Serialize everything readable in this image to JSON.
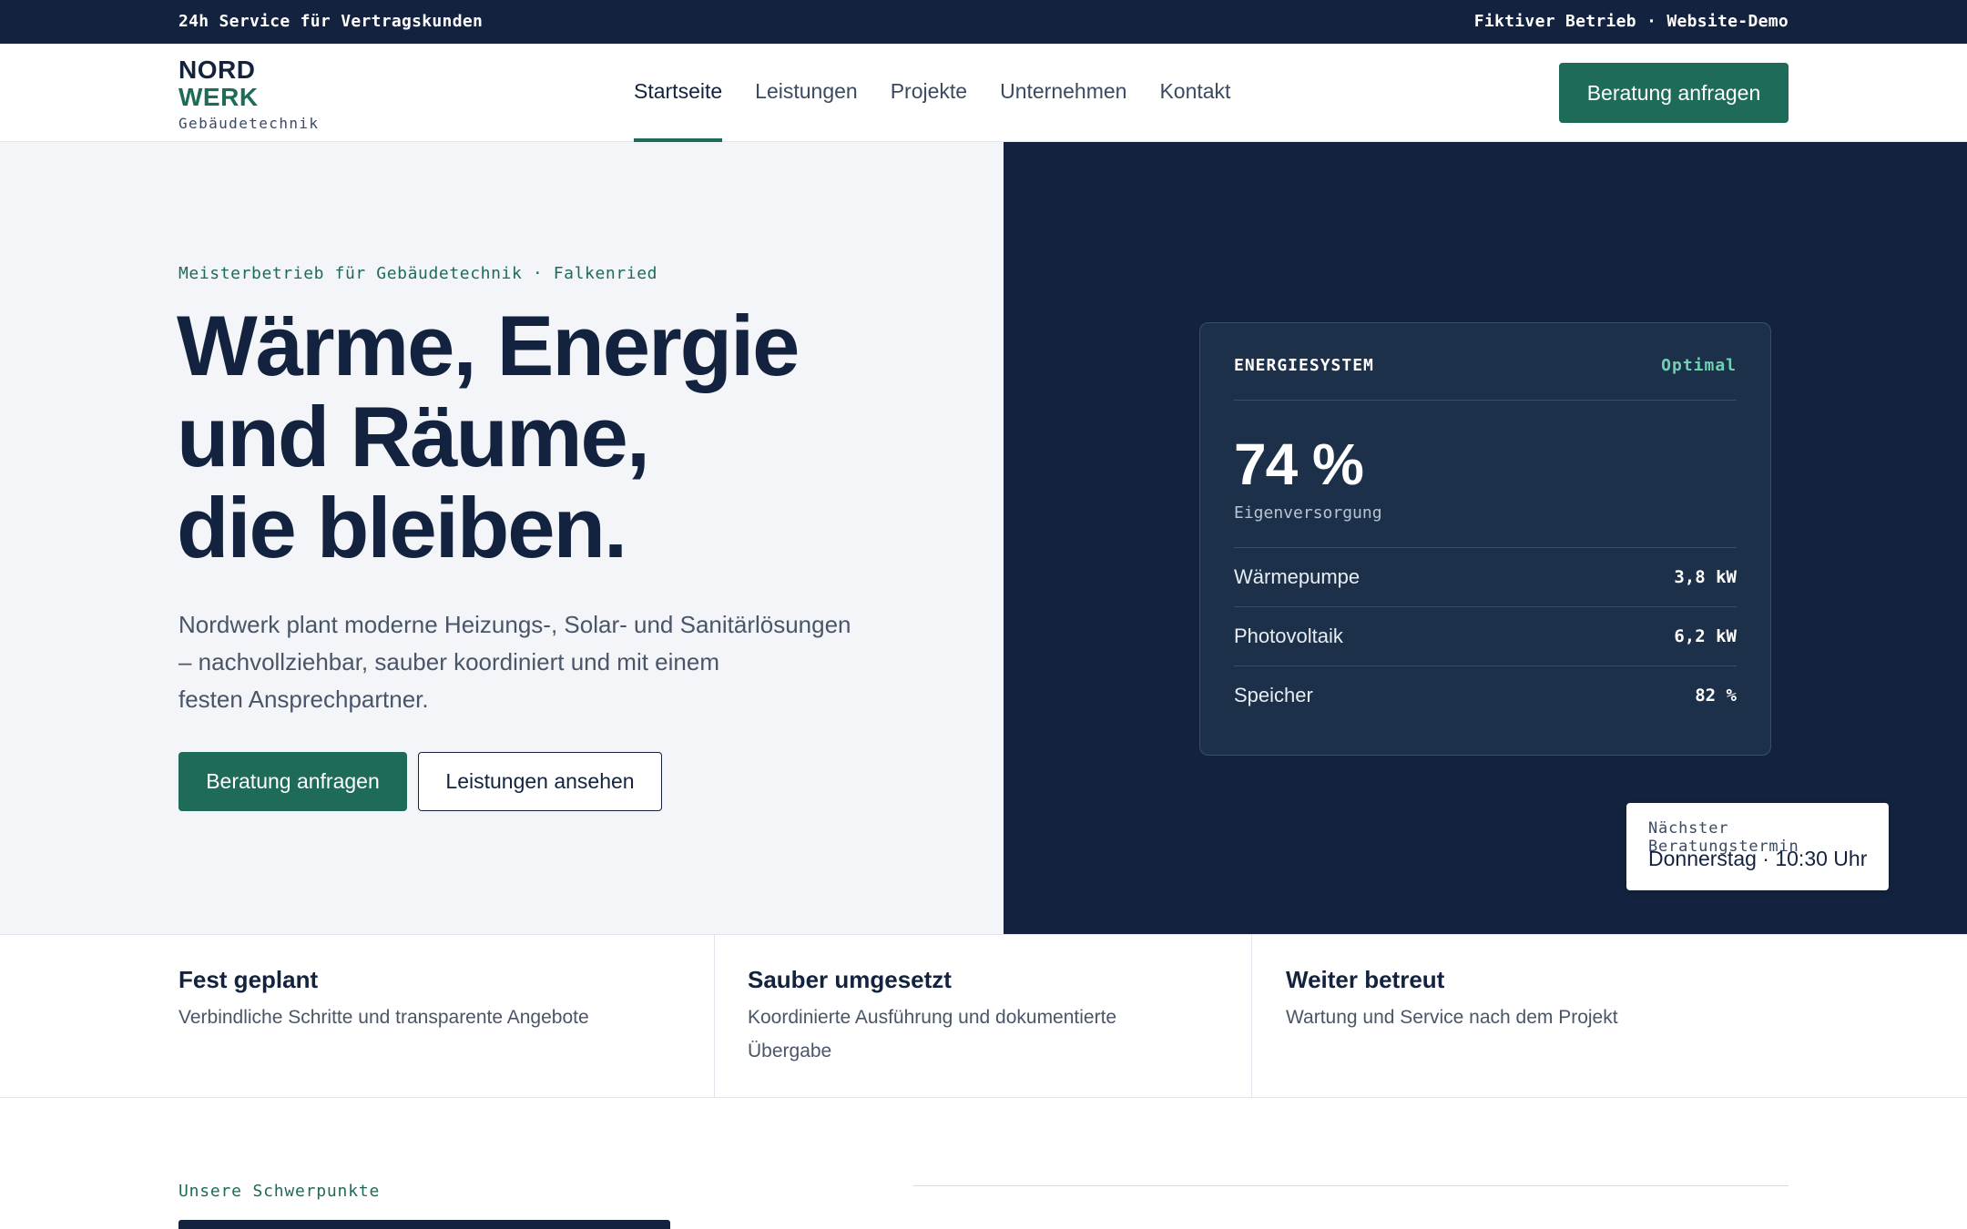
{
  "topbar": {
    "left_text": "24h Service für Vertragskunden",
    "right_text": "Fiktiver Betrieb · Website-Demo"
  },
  "header": {
    "logo": {
      "line1": "NORD",
      "line2": "WERK",
      "line3": "Gebäudetechnik"
    },
    "nav": [
      {
        "label": "Startseite",
        "active": true
      },
      {
        "label": "Leistungen",
        "active": false
      },
      {
        "label": "Projekte",
        "active": false
      },
      {
        "label": "Unternehmen",
        "active": false
      },
      {
        "label": "Kontakt",
        "active": false
      }
    ],
    "cta_label": "Beratung anfragen"
  },
  "hero": {
    "eyebrow": "Meisterbetrieb für Gebäudetechnik · Falkenried",
    "headline": [
      "Wärme, Energie",
      "und Räume,",
      "die bleiben."
    ],
    "lead": [
      "Nordwerk plant moderne Heizungs-, Solar- und Sanitärlösungen",
      "– nachvollziehbar, sauber koordiniert und mit einem",
      "festen Ansprechpartner."
    ],
    "primary_button": "Beratung anfragen",
    "secondary_button": "Leistungen ansehen"
  },
  "energy_card": {
    "title": "ENERGIESYSTEM",
    "status": "Optimal",
    "big_value": "74 %",
    "big_label": "Eigenversorgung",
    "rows": [
      {
        "name": "Wärmepumpe",
        "value": "3,8 kW"
      },
      {
        "name": "Photovoltaik",
        "value": "6,2 kW"
      },
      {
        "name": "Speicher",
        "value": "82 %"
      }
    ]
  },
  "appointment": {
    "label": "Nächster Beratungstermin",
    "value": "Donnerstag · 10:30 Uhr"
  },
  "features": [
    {
      "title": "Fest geplant",
      "text": "Verbindliche Schritte und transparente Angebote"
    },
    {
      "title": "Sauber umgesetzt",
      "text": "Koordinierte Ausführung und dokumentierte Übergabe"
    },
    {
      "title": "Weiter betreut",
      "text": "Wartung und Service nach dem Projekt"
    }
  ],
  "section": {
    "eyebrow": "Unsere Schwerpunkte"
  },
  "colors": {
    "navy": "#13233f",
    "green": "#1e6b5a",
    "card": "#1d3049",
    "status_green": "#6fd1b0",
    "hero_left_bg": "#f3f5f8"
  }
}
